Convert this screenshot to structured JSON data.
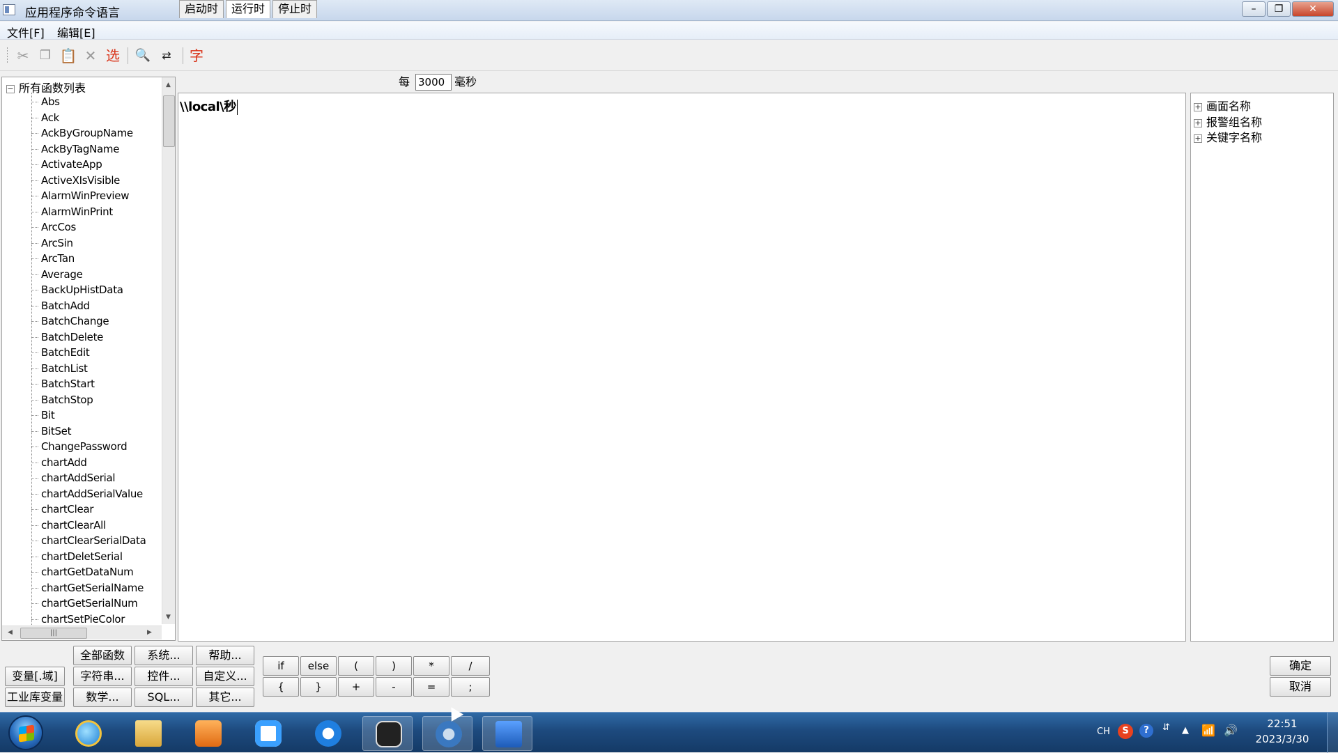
{
  "window": {
    "title": "应用程序命令语言",
    "minimize_label": "–",
    "maximize_label": "❐",
    "close_label": "✕"
  },
  "menu": {
    "file": "文件[F]",
    "edit": "编辑[E]"
  },
  "toolbar": {
    "icons": [
      "cut-icon",
      "copy-icon",
      "paste-icon",
      "delete-icon",
      "select-icon",
      "find-icon",
      "replace-icon",
      "font-icon"
    ],
    "select_label": "选",
    "font_label": "字"
  },
  "function_tree": {
    "root_label": "所有函数列表",
    "items": [
      "Abs",
      "Ack",
      "AckByGroupName",
      "AckByTagName",
      "ActivateApp",
      "ActiveXIsVisible",
      "AlarmWinPreview",
      "AlarmWinPrint",
      "ArcCos",
      "ArcSin",
      "ArcTan",
      "Average",
      "BackUpHistData",
      "BatchAdd",
      "BatchChange",
      "BatchDelete",
      "BatchEdit",
      "BatchList",
      "BatchStart",
      "BatchStop",
      "Bit",
      "BitSet",
      "ChangePassword",
      "chartAdd",
      "chartAddSerial",
      "chartAddSerialValue",
      "chartClear",
      "chartClearAll",
      "chartClearSerialData",
      "chartDeletSerial",
      "chartGetDataNum",
      "chartGetSerialName",
      "chartGetSerialNum",
      "chartSetPieColor"
    ]
  },
  "tabs": {
    "start": "启动时",
    "run": "运行时",
    "stop": "停止时"
  },
  "interval": {
    "prefix": "每",
    "value": "3000",
    "unit": "毫秒"
  },
  "editor": {
    "content": "\\\\local\\秒"
  },
  "right_tree": {
    "items": [
      "画面名称",
      "报警组名称",
      "关键字名称"
    ]
  },
  "bottom_buttons": {
    "variable": "变量[.域]",
    "library_variable": "工业库变量",
    "all_functions": "全部函数",
    "system": "系统...",
    "help": "帮助...",
    "string": "字符串...",
    "control": "控件...",
    "custom": "自定义...",
    "math": "数学...",
    "sql": "SQL...",
    "other": "其它..."
  },
  "operators": {
    "if": "if",
    "else": "else",
    "lparen": "(",
    "rparen": ")",
    "mul": "*",
    "div": "/",
    "lbrace": "{",
    "rbrace": "}",
    "plus": "+",
    "minus": "-",
    "eq": "=",
    "semi": ";"
  },
  "dialog": {
    "ok": "确定",
    "cancel": "取消"
  },
  "taskbar": {
    "apps": [
      "internet-explorer-icon",
      "file-explorer-icon",
      "media-player-icon",
      "baidu-netdisk-icon",
      "sogou-icon",
      "robot-app-icon",
      "settings-app-icon",
      "kingview-app-icon"
    ],
    "tray_lang": "CH",
    "time": "22:51",
    "date": "2023/3/30"
  },
  "colors": {
    "taskbar": "#1d4a7e",
    "accent_red": "#d9341a"
  }
}
